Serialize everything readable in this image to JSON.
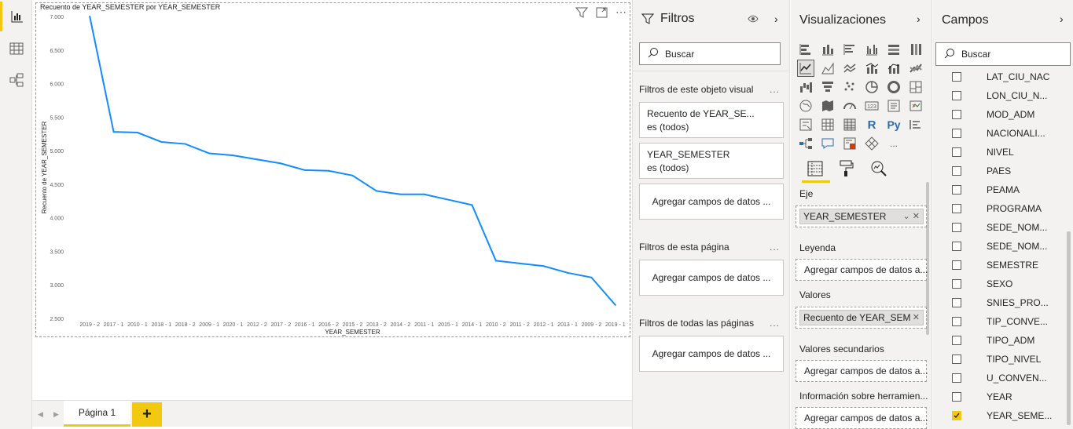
{
  "visual": {
    "title": "Recuento de YEAR_SEMESTER por YEAR_SEMESTER"
  },
  "chart_data": {
    "type": "line",
    "title": "Recuento de YEAR_SEMESTER por YEAR_SEMESTER",
    "xlabel": "YEAR_SEMESTER",
    "ylabel": "Recuento de YEAR_SEMESTER",
    "ylim": [
      2500,
      7000
    ],
    "y_ticks": [
      "2.500",
      "3.000",
      "3.500",
      "4.000",
      "4.500",
      "5.000",
      "5.500",
      "6.000",
      "6.500",
      "7.000"
    ],
    "categories": [
      "2019 - 2",
      "2017 - 1",
      "2010 - 1",
      "2018 - 1",
      "2018 - 2",
      "2009 - 1",
      "2020 - 1",
      "2012 - 2",
      "2017 - 2",
      "2016 - 1",
      "2016 - 2",
      "2015 - 2",
      "2013 - 2",
      "2014 - 2",
      "2011 - 1",
      "2015 - 1",
      "2014 - 1",
      "2010 - 2",
      "2011 - 2",
      "2012 - 1",
      "2013 - 1",
      "2009 - 2",
      "2019 - 1"
    ],
    "series": [
      {
        "values": [
          7000,
          5280,
          5270,
          5130,
          5100,
          4960,
          4930,
          4870,
          4810,
          4710,
          4700,
          4630,
          4400,
          4350,
          4350,
          4270,
          4190,
          3360,
          3320,
          3280,
          3180,
          3110,
          2700
        ],
        "color": "#118dff"
      }
    ],
    "grid": false
  },
  "toolbar_icons": [
    "filter-icon",
    "focus-mode-icon",
    "more-options-icon"
  ],
  "tabs": {
    "page_label": "Página 1",
    "add_label": "+"
  },
  "filters": {
    "title": "Filtros",
    "search_placeholder": "Buscar",
    "section_visual": "Filtros de este objeto visual",
    "card1": {
      "name": "Recuento de YEAR_SE...",
      "state": "es (todos)"
    },
    "card2": {
      "name": "YEAR_SEMESTER",
      "state": "es (todos)"
    },
    "add_fields": "Agregar campos de datos ...",
    "section_page": "Filtros de esta página",
    "section_all": "Filtros de todas las páginas",
    "more": "..."
  },
  "viz": {
    "title": "Visualizaciones",
    "eje_label": "Eje",
    "eje_field": "YEAR_SEMESTER",
    "leyenda_label": "Leyenda",
    "add_fields": "Agregar campos de datos a...",
    "valores_label": "Valores",
    "valores_field": "Recuento de YEAR_SEM",
    "sec_label": "Valores secundarios",
    "tooltip_label": "Información sobre herramien...",
    "more": "...",
    "r_label": "R",
    "py_label": "Py"
  },
  "fields": {
    "title": "Campos",
    "search_placeholder": "Buscar",
    "items": [
      {
        "name": "LAT_CIU_NAC",
        "checked": false
      },
      {
        "name": "LON_CIU_N...",
        "checked": false
      },
      {
        "name": "MOD_ADM",
        "checked": false
      },
      {
        "name": "NACIONALI...",
        "checked": false
      },
      {
        "name": "NIVEL",
        "checked": false
      },
      {
        "name": "PAES",
        "checked": false
      },
      {
        "name": "PEAMA",
        "checked": false
      },
      {
        "name": "PROGRAMA",
        "checked": false
      },
      {
        "name": "SEDE_NOM...",
        "checked": false
      },
      {
        "name": "SEDE_NOM...",
        "checked": false
      },
      {
        "name": "SEMESTRE",
        "checked": false
      },
      {
        "name": "SEXO",
        "checked": false
      },
      {
        "name": "SNIES_PRO...",
        "checked": false
      },
      {
        "name": "TIP_CONVE...",
        "checked": false
      },
      {
        "name": "TIPO_ADM",
        "checked": false
      },
      {
        "name": "TIPO_NIVEL",
        "checked": false
      },
      {
        "name": "U_CONVEN...",
        "checked": false
      },
      {
        "name": "YEAR",
        "checked": false
      },
      {
        "name": "YEAR_SEME...",
        "checked": true
      }
    ]
  },
  "colors": {
    "accent": "#f2c811",
    "line": "#118dff",
    "pane_bg": "#f3f2f1"
  }
}
